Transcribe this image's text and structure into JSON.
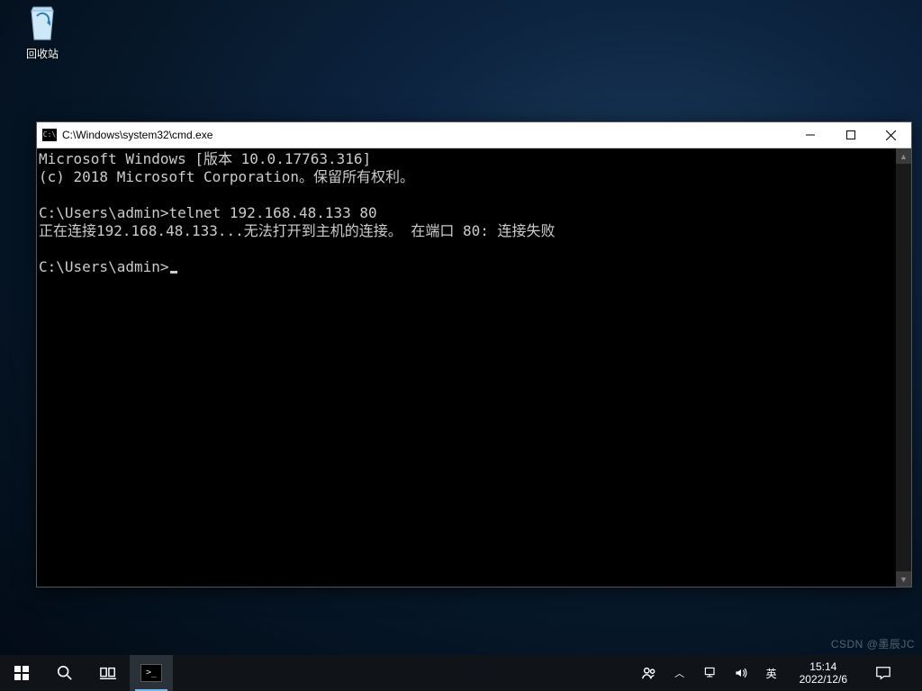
{
  "desktop": {
    "recycle_bin": {
      "label": "回收站"
    }
  },
  "cmd_window": {
    "title": "C:\\Windows\\system32\\cmd.exe",
    "controls": {
      "minimize": "minimize",
      "maximize": "maximize",
      "close": "close"
    },
    "lines": {
      "l1": "Microsoft Windows [版本 10.0.17763.316]",
      "l2": "(c) 2018 Microsoft Corporation。保留所有权利。",
      "l3": "",
      "l4": "C:\\Users\\admin>telnet 192.168.48.133 80",
      "l5": "正在连接192.168.48.133...无法打开到主机的连接。 在端口 80: 连接失败",
      "l6": "",
      "l7": "C:\\Users\\admin>"
    }
  },
  "watermark": "CSDN @墨辰JC",
  "taskbar": {
    "ime": "英",
    "clock": {
      "time": "15:14",
      "date": "2022/12/6"
    }
  }
}
